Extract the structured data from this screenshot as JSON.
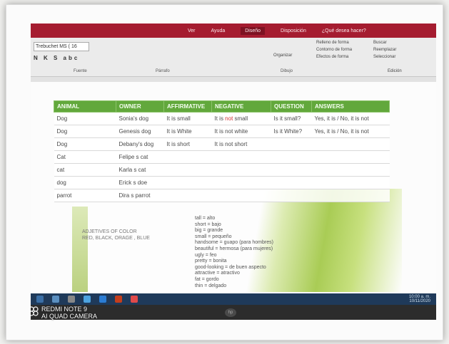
{
  "menubar": {
    "items": [
      "Ver",
      "Ayuda",
      "Diseño",
      "Disposición",
      "¿Qué desea hacer?"
    ],
    "active": "Diseño"
  },
  "ribbon": {
    "font_name": "Trebuchet MS (",
    "font_size": "16",
    "format_row": "N K S abc",
    "groups": [
      "Fuente",
      "Párrafo",
      "Dibujo"
    ],
    "right_items": [
      "Relleno de forma",
      "Contorno de forma",
      "Efectos de forma",
      "Buscar",
      "Reemplazar",
      "Seleccionar",
      "Organizar",
      "Edición"
    ]
  },
  "table": {
    "headers": [
      "ANIMAL",
      "OWNER",
      "AFFIRMATIVE",
      "NEGATIVE",
      "QUESTION",
      "ANSWERS"
    ],
    "rows": [
      [
        "Dog",
        "Sonia's dog",
        "It is small",
        "It is not small",
        "Is it small?",
        "Yes, it is / No, it is not"
      ],
      [
        "Dog",
        "Genesis dog",
        "It is White",
        "It is not white",
        "Is it White?",
        "Yes, it is / No, it is not"
      ],
      [
        "Dog",
        "Debany's dog",
        "It is short",
        "It is not short",
        "",
        ""
      ],
      [
        "Cat",
        "Felipe s cat",
        "",
        "",
        "",
        ""
      ],
      [
        "cat",
        "Karla s cat",
        "",
        "",
        "",
        ""
      ],
      [
        "dog",
        "Erick s doe",
        "",
        "",
        "",
        ""
      ],
      [
        "parrot",
        "Dira s parrot",
        "",
        "",
        "",
        ""
      ]
    ],
    "highlight_word": "not"
  },
  "adjectives": {
    "title": "ADJETIVES OF COLOR",
    "list": "RED, BLACK, ORAGE , BLUE"
  },
  "vocab": [
    "tall = alto",
    "short = bajo",
    "big = grande",
    "small = pequeño",
    "handsome = guapo (para hombres)",
    "beautiful = hermosa (para mujeres)",
    "ugly = feo",
    "pretty = bonita",
    "good-looking = de buen aspecto",
    "attractive = atractivo",
    "fat = gordo",
    "thin = delgado"
  ],
  "taskbar": {
    "time": "10:00 a. m.",
    "date": "10/11/2020"
  },
  "laptop_logo": "hp",
  "watermark": {
    "line1": "REDMI NOTE 9",
    "line2": "AI QUAD CAMERA"
  },
  "colors": {
    "header_green": "#62a83c",
    "menu_red": "#a51c30",
    "negative_red": "#d23030"
  }
}
